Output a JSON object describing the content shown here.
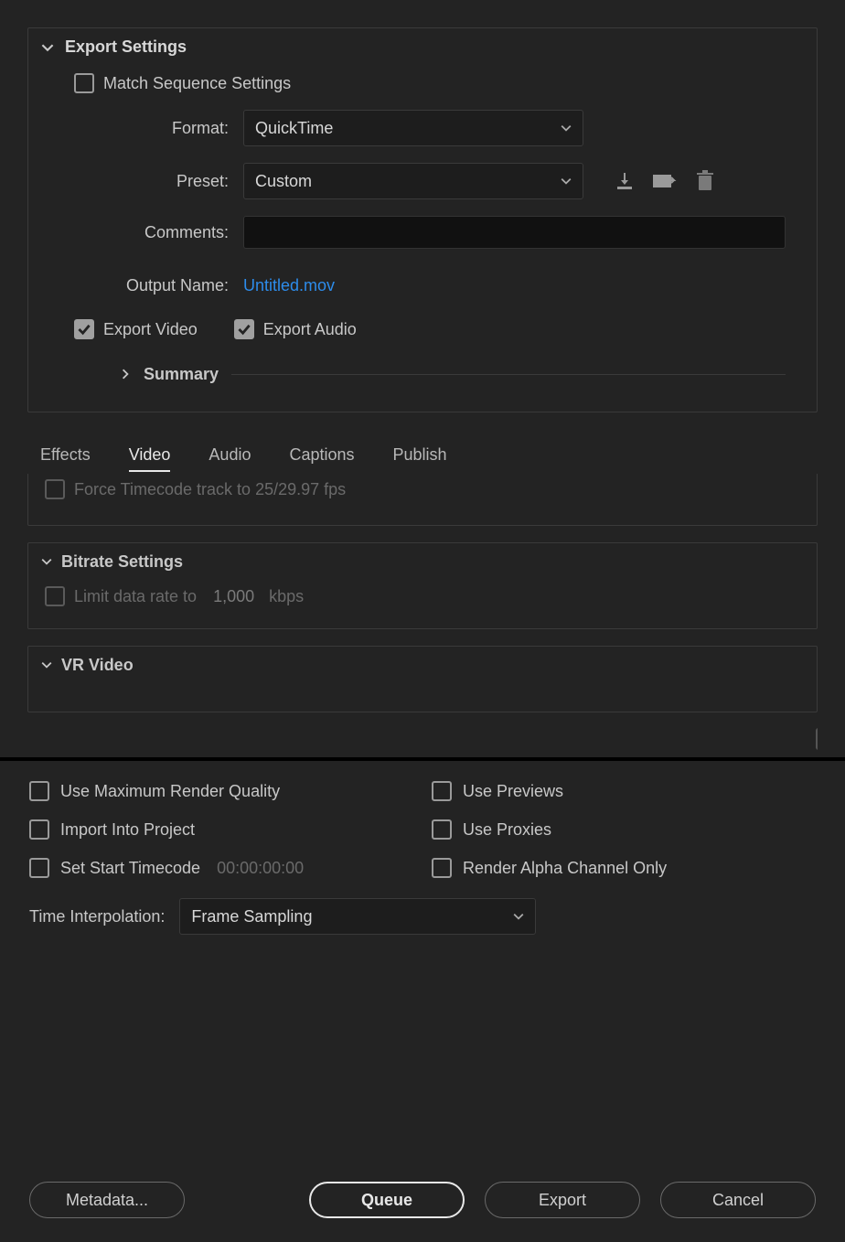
{
  "export_settings": {
    "title": "Export Settings",
    "match_sequence_label": "Match Sequence Settings",
    "format_label": "Format:",
    "format_value": "QuickTime",
    "preset_label": "Preset:",
    "preset_value": "Custom",
    "comments_label": "Comments:",
    "comments_value": "",
    "output_name_label": "Output Name:",
    "output_name_value": "Untitled.mov",
    "export_video_label": "Export Video",
    "export_audio_label": "Export Audio",
    "summary_label": "Summary"
  },
  "tabs": {
    "effects": "Effects",
    "video": "Video",
    "audio": "Audio",
    "captions": "Captions",
    "publish": "Publish",
    "active": "video"
  },
  "video_panel": {
    "force_timecode_label": "Force Timecode track to 25/29.97 fps",
    "bitrate_title": "Bitrate Settings",
    "limit_rate_label": "Limit data rate to",
    "limit_rate_value": "1,000",
    "limit_rate_unit": "kbps",
    "vr_title": "VR Video"
  },
  "bottom": {
    "max_render": "Use Maximum Render Quality",
    "use_previews": "Use Previews",
    "import_project": "Import Into Project",
    "use_proxies": "Use Proxies",
    "set_start_tc": "Set Start Timecode",
    "set_start_tc_value": "00:00:00:00",
    "render_alpha": "Render Alpha Channel Only",
    "time_interp_label": "Time Interpolation:",
    "time_interp_value": "Frame Sampling"
  },
  "buttons": {
    "metadata": "Metadata...",
    "queue": "Queue",
    "export": "Export",
    "cancel": "Cancel"
  }
}
